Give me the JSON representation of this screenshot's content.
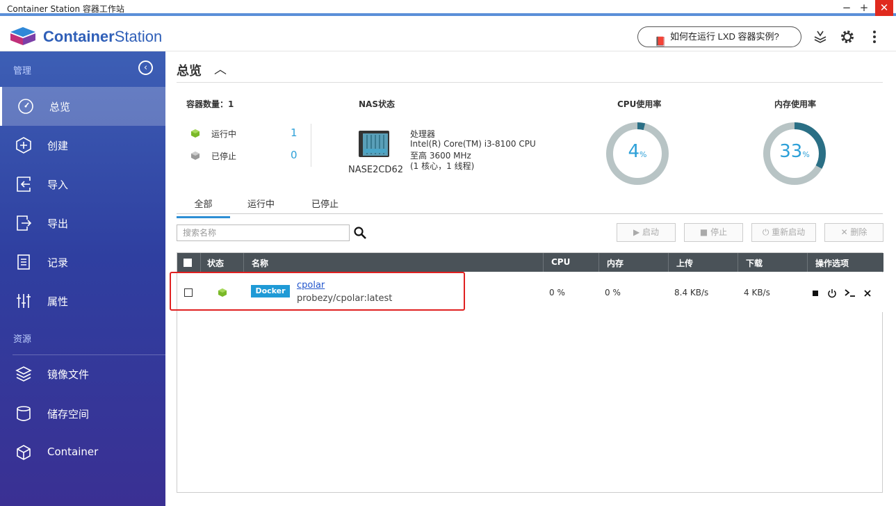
{
  "window": {
    "title": "Container Station 容器工作站",
    "minimize": "−",
    "maximize": "+",
    "close": "✕"
  },
  "header": {
    "brand_bold": "Container",
    "brand_light": "Station",
    "lxd_button": "如何在运行 LXD 容器实例?",
    "icons": [
      "stack-icon",
      "gear-icon",
      "more-icon"
    ]
  },
  "sidebar": {
    "section_manage": "管理",
    "section_resource": "资源",
    "items": [
      {
        "label": "总览",
        "icon": "dashboard-icon",
        "active": true
      },
      {
        "label": "创建",
        "icon": "plus-icon"
      },
      {
        "label": "导入",
        "icon": "import-icon"
      },
      {
        "label": "导出",
        "icon": "export-icon"
      },
      {
        "label": "记录",
        "icon": "log-icon"
      },
      {
        "label": "属性",
        "icon": "sliders-icon"
      }
    ],
    "resources": [
      {
        "label": "镜像文件",
        "icon": "layers-icon"
      },
      {
        "label": "储存空间",
        "icon": "database-icon"
      },
      {
        "label": "Container",
        "icon": "box-icon"
      }
    ]
  },
  "overview": {
    "title": "总览",
    "container_count_label": "容器数量：1",
    "running_label": "运行中",
    "running_count": "1",
    "stopped_label": "已停止",
    "stopped_count": "0",
    "nas_status_label": "NAS状态",
    "nas_name": "NASE2CD62",
    "cpu_title": "处理器",
    "cpu_model": "Intel(R) Core(TM) i3-8100 CPU",
    "cpu_freq": "至高 3600 MHz",
    "cpu_cores": "(1 核心，1 线程)",
    "cpu_usage_label": "CPU使用率",
    "cpu_usage": "4",
    "mem_usage_label": "内存使用率",
    "mem_usage": "33",
    "percent": "%"
  },
  "tabs": [
    "全部",
    "运行中",
    "已停止"
  ],
  "search": {
    "placeholder": "搜索名称"
  },
  "actions": {
    "start": "▶ 启动",
    "stop": "■ 停止",
    "restart": "⏻ 重新启动",
    "delete": "✕ 删除"
  },
  "table": {
    "columns": [
      "状态",
      "名称",
      "CPU",
      "内存",
      "上传",
      "下载",
      "操作选项"
    ],
    "rows": [
      {
        "type": "Docker",
        "name": "cpolar",
        "image": "probezy/cpolar:latest",
        "cpu": "0 %",
        "mem": "0 %",
        "up": "8.4 KB/s",
        "down": "4 KB/s"
      }
    ]
  },
  "colors": {
    "accent": "#2da0d8",
    "sidebar": "#3a44a0",
    "running": "#7ab829"
  }
}
